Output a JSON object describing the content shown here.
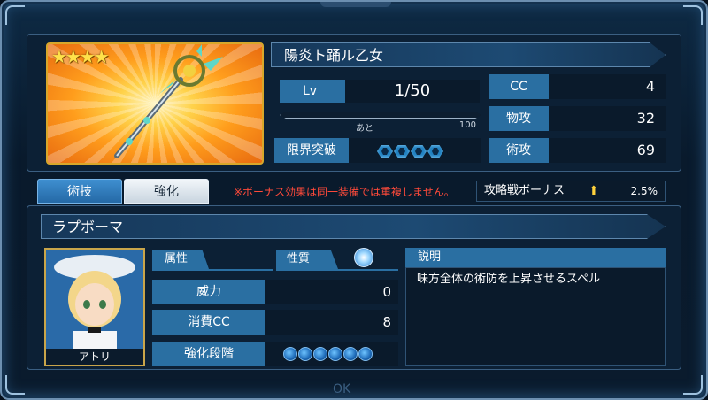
{
  "weapon": {
    "name": "陽炎ト踊ル乙女",
    "rarity_stars": "★★★★"
  },
  "level": {
    "label": "Lv",
    "value": "1/50"
  },
  "exp": {
    "prefix": "あと",
    "remaining": "100"
  },
  "limit_break": {
    "label": "限界突破",
    "count": 4
  },
  "stats": [
    {
      "label": "CC",
      "value": "4"
    },
    {
      "label": "物攻",
      "value": "32"
    },
    {
      "label": "術攻",
      "value": "69"
    }
  ],
  "tabs": {
    "skill": "術技",
    "enhance": "強化"
  },
  "notice": "※ボーナス効果は同一装備では重複しません。",
  "bonus": {
    "label": "攻略戦ボーナス",
    "value": "2.5%"
  },
  "skill": {
    "name": "ラプボーマ",
    "character": "アトリ",
    "attribute_label": "属性",
    "property_label": "性質",
    "power_label": "威力",
    "power_value": "0",
    "cost_label": "消費CC",
    "cost_value": "8",
    "enhance_label": "強化段階",
    "enhance_max": 6,
    "description_label": "説明",
    "description": "味方全体の術防を上昇させるスペル"
  },
  "footer": {
    "ok": "OK"
  },
  "colors": {
    "accent": "#2a6fa2",
    "gold": "#d8a72a",
    "warning": "#ff4a3a"
  }
}
